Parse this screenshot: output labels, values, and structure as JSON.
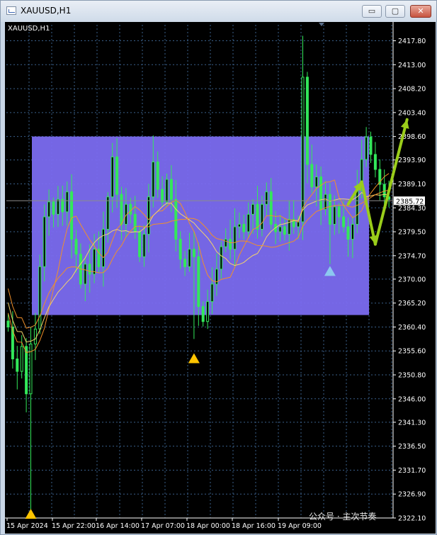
{
  "window": {
    "title": "XAUUSD,H1",
    "minimize_symbol": "▭",
    "maximize_symbol": "▢",
    "close_symbol": "✕"
  },
  "chart": {
    "symbol_label": "XAUUSD,H1",
    "current_price": "2385.72",
    "watermark": "公众号 · 主次节奏",
    "colors": {
      "background": "#000000",
      "grid": "#3a5f8a",
      "zone": "#7b6cf0",
      "candle": "#33e85a",
      "ma_orange": "#f0902a",
      "ma_yellow": "#f5d36a",
      "arrow": "#9acd1a",
      "marker_yellow": "#ffc400",
      "marker_blue": "#8cc8f0"
    }
  },
  "chart_data": {
    "type": "candlestick",
    "price_axis_labels": [
      "2417.80",
      "2413.00",
      "2408.20",
      "2403.40",
      "2398.60",
      "2393.90",
      "2389.10",
      "2384.30",
      "2379.50",
      "2374.70",
      "2370.00",
      "2365.20",
      "2360.40",
      "2355.60",
      "2350.80",
      "2346.00",
      "2341.30",
      "2336.50",
      "2331.70",
      "2326.90",
      "2322.10"
    ],
    "time_axis_labels": [
      "15 Apr 2024",
      "15 Apr 22:00",
      "16 Apr 14:00",
      "17 Apr 07:00",
      "18 Apr 00:00",
      "18 Apr 16:00",
      "19 Apr 09:00"
    ],
    "ylim": [
      2322.1,
      2421.0
    ],
    "current_price": 2385.72,
    "zone_range": [
      2362.8,
      2398.6
    ],
    "close_path": [
      2360.4,
      2354.0,
      2351.5,
      2356.5,
      2347.0,
      2357.0,
      2360.0,
      2372.5,
      2382.5,
      2385.5,
      2383.0,
      2386.0,
      2383.5,
      2387.5,
      2378.0,
      2375.0,
      2369.0,
      2373.0,
      2371.0,
      2376.0,
      2372.5,
      2380.0,
      2386.5,
      2394.5,
      2387.0,
      2381.0,
      2385.0,
      2383.0,
      2379.5,
      2374.5,
      2379.0,
      2386.5,
      2393.5,
      2388.0,
      2385.5,
      2390.0,
      2386.0,
      2378.0,
      2374.0,
      2372.5,
      2376.0,
      2374.5,
      2364.5,
      2361.5,
      2365.5,
      2369.0,
      2372.0,
      2376.5,
      2378.0,
      2376.0,
      2380.5,
      2381.0,
      2379.5,
      2383.0,
      2385.0,
      2380.0,
      2385.0,
      2387.5,
      2381.0,
      2379.5,
      2380.5,
      2379.0,
      2382.0,
      2380.5,
      2381.5,
      2410.5,
      2393.0,
      2388.5,
      2390.5,
      2384.0,
      2387.0,
      2381.0,
      2384.5,
      2382.5,
      2380.5,
      2378.0,
      2381.0,
      2388.5,
      2394.0,
      2398.5,
      2395.0,
      2392.0,
      2389.0,
      2386.5,
      2386.0
    ],
    "markers": [
      {
        "type": "triangle",
        "color": "yellow",
        "price": 2322.8,
        "time_index": 5
      },
      {
        "type": "triangle",
        "color": "yellow",
        "price": 2354.0,
        "time_index": 41
      },
      {
        "type": "triangle",
        "color": "blue",
        "price": 2371.5,
        "time_index": 71
      }
    ],
    "arrows": [
      {
        "from": [
          75,
          2385.0
        ],
        "to": [
          78,
          2389.5
        ]
      },
      {
        "from": [
          78,
          2389.5
        ],
        "to": [
          81,
          2377.0
        ]
      },
      {
        "from": [
          81,
          2377.0
        ],
        "to": [
          88,
          2402.0
        ]
      }
    ]
  }
}
